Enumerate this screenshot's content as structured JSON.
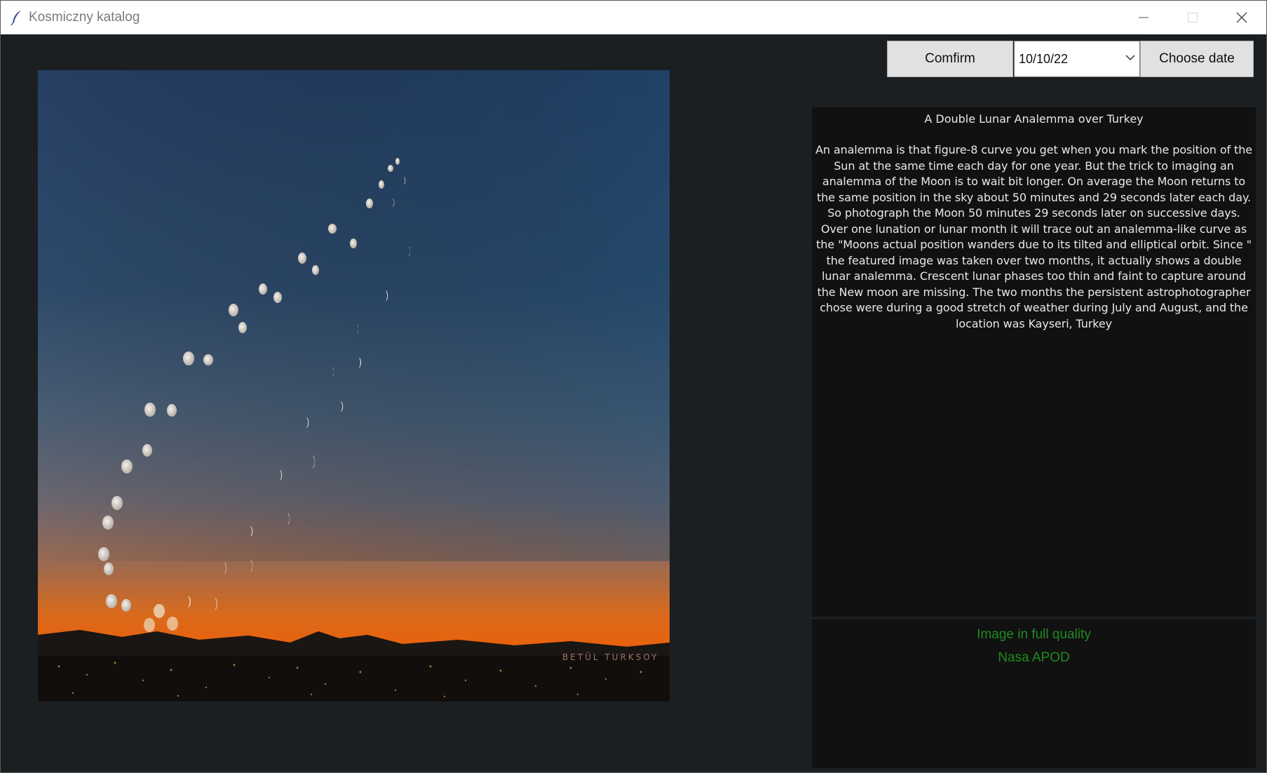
{
  "window": {
    "title": "Kosmiczny katalog"
  },
  "toolbar": {
    "confirm_label": "Comfirm",
    "date_value": "10/10/22",
    "choose_date_label": "Choose date"
  },
  "apod": {
    "title": "A Double Lunar Analemma over Turkey",
    "body": "An analemma is that figure-8 curve you get when you mark the position of the Sun at the same time each day for one year. But the trick to imaging an analemma of the Moon is to wait bit longer. On average the Moon returns to the same position in the sky about 50 minutes and 29 seconds later each day. So photograph the Moon 50 minutes 29 seconds later on successive days. Over one lunation or lunar month it will trace out an analemma-like curve as the \"Moons actual position wanders due to its tilted and elliptical orbit. Since \" the featured image was taken over two months, it actually shows a double lunar analemma.  Crescent lunar phases too thin and faint to capture around the New moon are missing. The two months the persistent astrophotographer chose were during a good stretch of weather during July and August, and the location was Kayseri, Turkey",
    "watermark": "BETÜL TURKSOY"
  },
  "links": {
    "full_quality": "Image in full quality",
    "source": "Nasa APOD"
  },
  "colors": {
    "background": "#1c1f22",
    "panel": "#111111",
    "link": "#1f8a1f"
  }
}
